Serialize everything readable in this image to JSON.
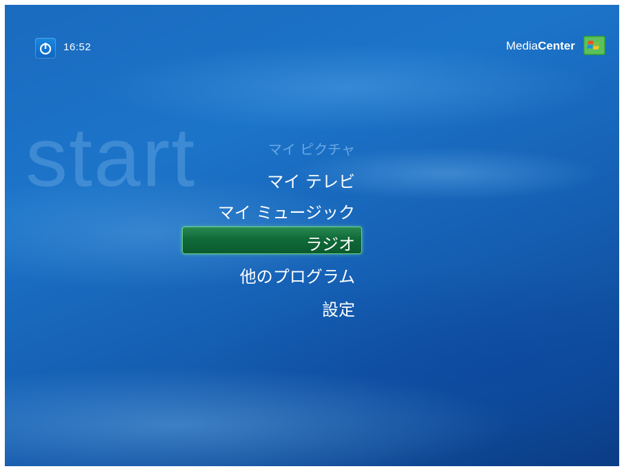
{
  "header": {
    "power_icon": "power-icon",
    "time": "16:52",
    "brand_regular": "Media",
    "brand_bold": "Center",
    "logo_icon": "windows-flag-icon"
  },
  "watermark": "start",
  "menu": {
    "items": [
      {
        "label": "マイ ピクチャ",
        "state": "faded"
      },
      {
        "label": "マイ テレビ",
        "state": "normal"
      },
      {
        "label": "マイ ミュージック",
        "state": "normal"
      },
      {
        "label": "ラジオ",
        "state": "selected"
      },
      {
        "label": "他のプログラム",
        "state": "normal"
      },
      {
        "label": "設定",
        "state": "normal"
      }
    ]
  },
  "colors": {
    "background": "#1a6bbf",
    "selected": "#0f6a38",
    "selected_border": "#6fd68f",
    "text": "#ffffff"
  }
}
